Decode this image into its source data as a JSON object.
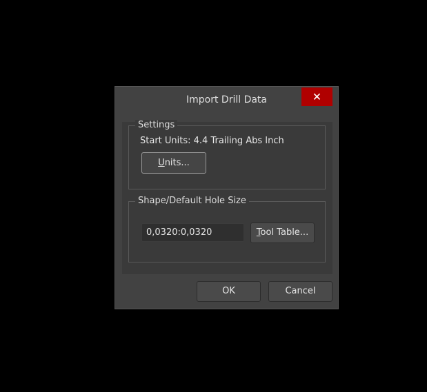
{
  "dialog": {
    "title": "Import Drill Data",
    "close_label": "✕"
  },
  "settings": {
    "legend": "Settings",
    "start_units": "Start Units: 4.4 Trailing Abs Inch",
    "units_button_first": "U",
    "units_button_rest": "nits..."
  },
  "hole_size": {
    "legend": "Shape/Default Hole Size",
    "value": "0,0320:0,0320",
    "tool_table_first": "T",
    "tool_table_rest": "ool Table..."
  },
  "footer": {
    "ok": "OK",
    "cancel": "Cancel"
  }
}
